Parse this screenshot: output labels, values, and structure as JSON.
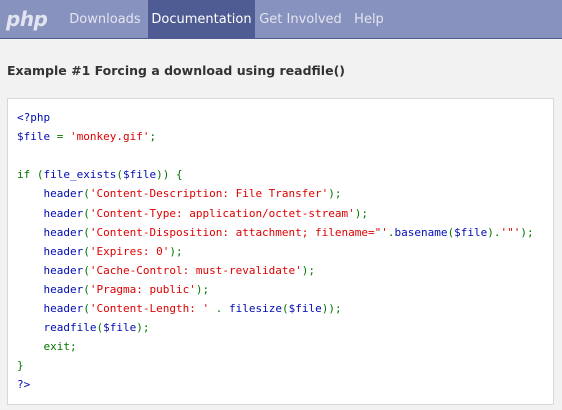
{
  "navbar": {
    "brand": "php",
    "items": [
      {
        "label": "Downloads",
        "active": false
      },
      {
        "label": "Documentation",
        "active": true
      },
      {
        "label": "Get Involved",
        "active": false
      },
      {
        "label": "Help",
        "active": false
      }
    ]
  },
  "example": {
    "title": "Example #1 Forcing a download using readfile()"
  },
  "code": {
    "lines": [
      [
        {
          "t": "<?php",
          "c": "kw"
        }
      ],
      [
        {
          "t": "$file",
          "c": "vr"
        },
        {
          "t": " = ",
          "c": "dn"
        },
        {
          "t": "'monkey.gif'",
          "c": "st"
        },
        {
          "t": ";",
          "c": "dn"
        }
      ],
      [],
      [
        {
          "t": "if (",
          "c": "dn"
        },
        {
          "t": "file_exists",
          "c": "kw"
        },
        {
          "t": "(",
          "c": "dn"
        },
        {
          "t": "$file",
          "c": "vr"
        },
        {
          "t": ")) {",
          "c": "dn"
        }
      ],
      [
        {
          "t": "    ",
          "c": "dn"
        },
        {
          "t": "header",
          "c": "kw"
        },
        {
          "t": "(",
          "c": "dn"
        },
        {
          "t": "'Content-Description: File Transfer'",
          "c": "st"
        },
        {
          "t": ");",
          "c": "dn"
        }
      ],
      [
        {
          "t": "    ",
          "c": "dn"
        },
        {
          "t": "header",
          "c": "kw"
        },
        {
          "t": "(",
          "c": "dn"
        },
        {
          "t": "'Content-Type: application/octet-stream'",
          "c": "st"
        },
        {
          "t": ");",
          "c": "dn"
        }
      ],
      [
        {
          "t": "    ",
          "c": "dn"
        },
        {
          "t": "header",
          "c": "kw"
        },
        {
          "t": "(",
          "c": "dn"
        },
        {
          "t": "'Content-Disposition: attachment; filename=\"'",
          "c": "st"
        },
        {
          "t": ".",
          "c": "dn"
        },
        {
          "t": "basename",
          "c": "kw"
        },
        {
          "t": "(",
          "c": "dn"
        },
        {
          "t": "$file",
          "c": "vr"
        },
        {
          "t": ").",
          "c": "dn"
        },
        {
          "t": "'\"'",
          "c": "st"
        },
        {
          "t": ");",
          "c": "dn"
        }
      ],
      [
        {
          "t": "    ",
          "c": "dn"
        },
        {
          "t": "header",
          "c": "kw"
        },
        {
          "t": "(",
          "c": "dn"
        },
        {
          "t": "'Expires: 0'",
          "c": "st"
        },
        {
          "t": ");",
          "c": "dn"
        }
      ],
      [
        {
          "t": "    ",
          "c": "dn"
        },
        {
          "t": "header",
          "c": "kw"
        },
        {
          "t": "(",
          "c": "dn"
        },
        {
          "t": "'Cache-Control: must-revalidate'",
          "c": "st"
        },
        {
          "t": ");",
          "c": "dn"
        }
      ],
      [
        {
          "t": "    ",
          "c": "dn"
        },
        {
          "t": "header",
          "c": "kw"
        },
        {
          "t": "(",
          "c": "dn"
        },
        {
          "t": "'Pragma: public'",
          "c": "st"
        },
        {
          "t": ");",
          "c": "dn"
        }
      ],
      [
        {
          "t": "    ",
          "c": "dn"
        },
        {
          "t": "header",
          "c": "kw"
        },
        {
          "t": "(",
          "c": "dn"
        },
        {
          "t": "'Content-Length: '",
          "c": "st"
        },
        {
          "t": " . ",
          "c": "dn"
        },
        {
          "t": "filesize",
          "c": "kw"
        },
        {
          "t": "(",
          "c": "dn"
        },
        {
          "t": "$file",
          "c": "vr"
        },
        {
          "t": "));",
          "c": "dn"
        }
      ],
      [
        {
          "t": "    ",
          "c": "dn"
        },
        {
          "t": "readfile",
          "c": "kw"
        },
        {
          "t": "(",
          "c": "dn"
        },
        {
          "t": "$file",
          "c": "vr"
        },
        {
          "t": ");",
          "c": "dn"
        }
      ],
      [
        {
          "t": "    ",
          "c": "dn"
        },
        {
          "t": "exit;",
          "c": "dn"
        }
      ],
      [
        {
          "t": "}",
          "c": "dn"
        }
      ],
      [
        {
          "t": "?>",
          "c": "kw"
        }
      ]
    ]
  },
  "colors": {
    "navbar_bg": "#8892bf",
    "nav_active_bg": "#4f5b93",
    "keyword": "#000bb3",
    "string": "#dd0000",
    "default": "#007700"
  }
}
